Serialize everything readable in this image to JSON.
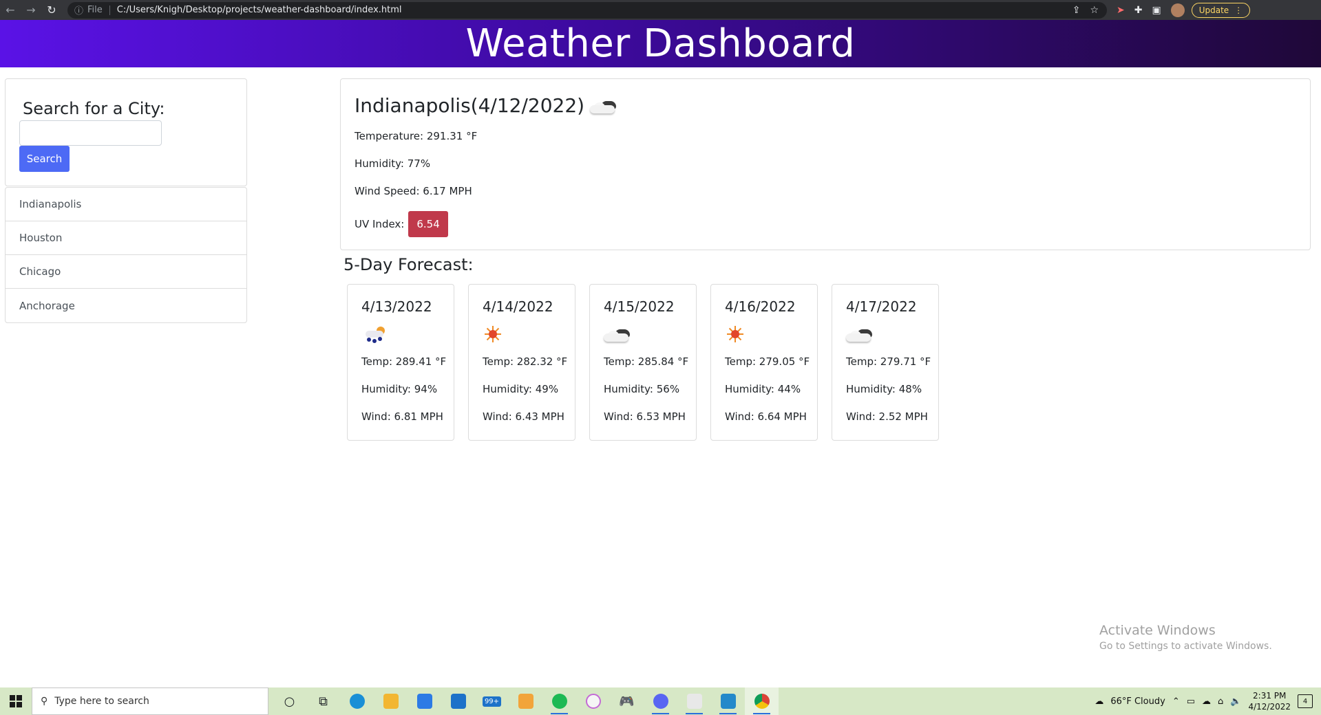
{
  "browser": {
    "info_icon": "ⓘ",
    "file_label": "File",
    "url": "C:/Users/Knigh/Desktop/projects/weather-dashboard/index.html",
    "update_label": "Update"
  },
  "header": {
    "title": "Weather Dashboard"
  },
  "search": {
    "title": "Search for a City:",
    "input_value": "",
    "button_label": "Search"
  },
  "history": [
    {
      "label": "Indianapolis"
    },
    {
      "label": "Houston"
    },
    {
      "label": "Chicago"
    },
    {
      "label": "Anchorage"
    }
  ],
  "current": {
    "title": "Indianapolis(4/12/2022)",
    "icon": "cloud-icon",
    "temperature": "Temperature: 291.31 °F",
    "humidity": "Humidity: 77%",
    "wind": "Wind Speed: 6.17 MPH",
    "uv_label": "UV Index:",
    "uv_value": "6.54",
    "uv_color": "#c0394b"
  },
  "forecast_title": "5-Day Forecast:",
  "forecast": [
    {
      "date": "4/13/2022",
      "icon": "rain-icon",
      "temp": "Temp: 289.41 °F",
      "humidity": "Humidity: 94%",
      "wind": "Wind: 6.81 MPH"
    },
    {
      "date": "4/14/2022",
      "icon": "sun-icon",
      "temp": "Temp: 282.32 °F",
      "humidity": "Humidity: 49%",
      "wind": "Wind: 6.43 MPH"
    },
    {
      "date": "4/15/2022",
      "icon": "cloud-icon",
      "temp": "Temp: 285.84 °F",
      "humidity": "Humidity: 56%",
      "wind": "Wind: 6.53 MPH"
    },
    {
      "date": "4/16/2022",
      "icon": "sun-icon",
      "temp": "Temp: 279.05 °F",
      "humidity": "Humidity: 44%",
      "wind": "Wind: 6.64 MPH"
    },
    {
      "date": "4/17/2022",
      "icon": "cloud-icon",
      "temp": "Temp: 279.71 °F",
      "humidity": "Humidity: 48%",
      "wind": "Wind: 2.52 MPH"
    }
  ],
  "watermark": {
    "line1": "Activate Windows",
    "line2": "Go to Settings to activate Windows."
  },
  "taskbar": {
    "search_placeholder": "Type here to search",
    "mail_badge": "99+",
    "weather": "66°F  Cloudy",
    "time": "2:31 PM",
    "date": "4/12/2022",
    "notification_count": "4"
  }
}
